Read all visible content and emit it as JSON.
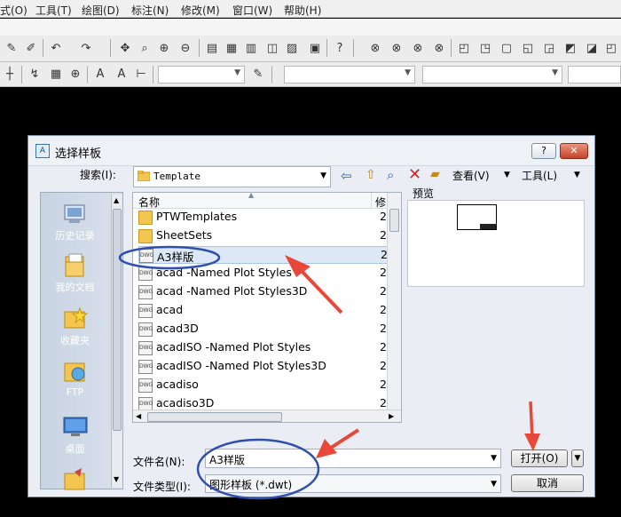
{
  "menubar": {
    "items": [
      "式(O)",
      "工具(T)",
      "绘图(D)",
      "标注(N)",
      "修改(M)",
      "窗口(W)",
      "帮助(H)"
    ]
  },
  "dialog": {
    "title": "选择样板",
    "help_button": "?",
    "close_button": "✕",
    "search_label": "搜索(I):",
    "search_folder": "Template",
    "toolbar": {
      "view_label": "查看(V)",
      "tools_label": "工具(L)"
    },
    "places": [
      {
        "label": "历史记录",
        "icon": "history-icon"
      },
      {
        "label": "我的文档",
        "icon": "my-documents-icon"
      },
      {
        "label": "收藏夹",
        "icon": "favorites-icon"
      },
      {
        "label": "FTP",
        "icon": "ftp-icon"
      },
      {
        "label": "桌面",
        "icon": "desktop-icon"
      }
    ],
    "list": {
      "header_name": "名称",
      "header_modified": "修",
      "rows": [
        {
          "name": "PTWTemplates",
          "type": "folder",
          "date": "2"
        },
        {
          "name": "SheetSets",
          "type": "folder",
          "date": "2"
        },
        {
          "name": "A3样版",
          "type": "dwt",
          "date": "2",
          "selected": true
        },
        {
          "name": "acad -Named Plot Styles",
          "type": "dwt",
          "date": "2"
        },
        {
          "name": "acad -Named Plot Styles3D",
          "type": "dwt",
          "date": "2"
        },
        {
          "name": "acad",
          "type": "dwt",
          "date": "2"
        },
        {
          "name": "acad3D",
          "type": "dwt",
          "date": "2"
        },
        {
          "name": "acadISO -Named Plot Styles",
          "type": "dwt",
          "date": "2"
        },
        {
          "name": "acadISO -Named Plot Styles3D",
          "type": "dwt",
          "date": "2"
        },
        {
          "name": "acadiso",
          "type": "dwt",
          "date": "2"
        },
        {
          "name": "acadiso3D",
          "type": "dwt",
          "date": "2"
        }
      ]
    },
    "preview_label": "预览",
    "filename_label": "文件名(N):",
    "filename_value": "A3样版",
    "filetype_label": "文件类型(I):",
    "filetype_value": "图形样板 (*.dwt)",
    "open_button": "打开(O)",
    "cancel_button": "取消"
  },
  "colors": {
    "annotation": "#2f4fb0",
    "arrow": "#e8483a",
    "selection": "#dde8f6"
  }
}
